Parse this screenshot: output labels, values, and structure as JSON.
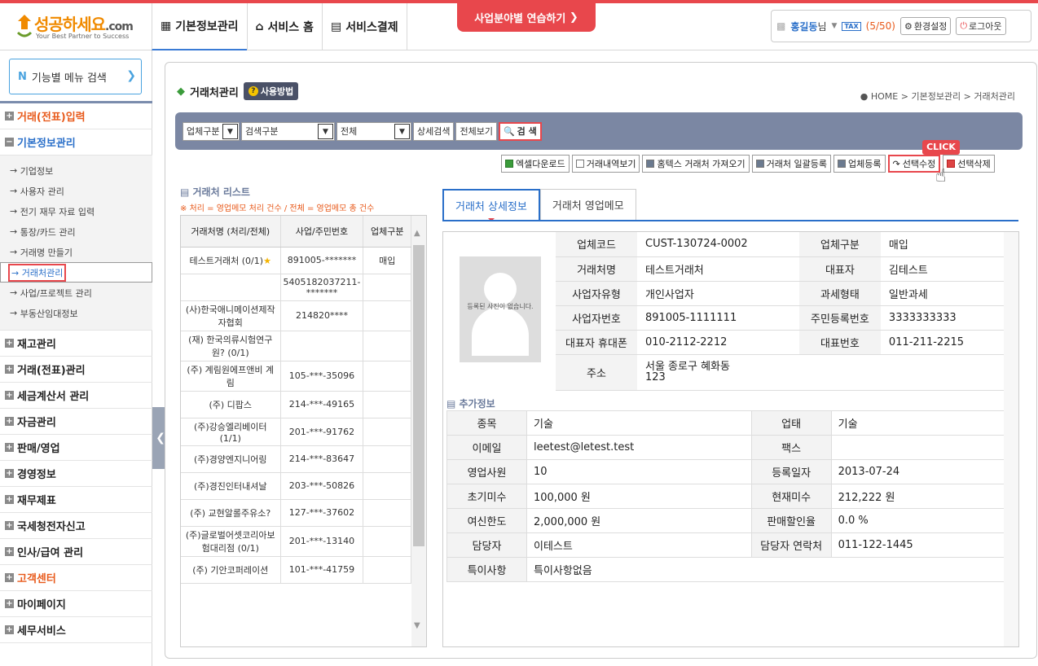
{
  "header": {
    "logo_main": "성공하세요",
    "logo_com": ".com",
    "logo_sub": "Your Best Partner to Success",
    "nav": [
      "기본정보관리",
      "서비스 홈",
      "서비스결제"
    ],
    "practice_btn": "사업분야별 연습하기",
    "user_name": "홍길동",
    "user_suffix": "님",
    "tax_label": "TAX",
    "tax_count": "(5/50)",
    "settings": "환경설정",
    "logout": "로그아웃"
  },
  "sidebar": {
    "func_search": "기능별 메뉴 검색",
    "menu": [
      {
        "label": "거래(전표)입력",
        "style": "orange"
      },
      {
        "label": "기본정보관리",
        "style": "blue"
      }
    ],
    "submenu": [
      "기업정보",
      "사용자 관리",
      "전기 재무 자료 입력",
      "통장/카드 관리",
      "거래명 만들기",
      "거래처관리",
      "사업/프로젝트 관리",
      "부동산임대정보"
    ],
    "menu2": [
      {
        "label": "재고관리",
        "style": ""
      },
      {
        "label": "거래(전표)관리",
        "style": ""
      },
      {
        "label": "세금계산서 관리",
        "style": ""
      },
      {
        "label": "자금관리",
        "style": ""
      },
      {
        "label": "판매/영업",
        "style": ""
      },
      {
        "label": "경영정보",
        "style": ""
      },
      {
        "label": "재무제표",
        "style": ""
      },
      {
        "label": "국세청전자신고",
        "style": ""
      },
      {
        "label": "인사/급여 관리",
        "style": ""
      },
      {
        "label": "고객센터",
        "style": "orange"
      },
      {
        "label": "마이페이지",
        "style": ""
      },
      {
        "label": "세무서비스",
        "style": ""
      }
    ]
  },
  "page": {
    "title": "거래처관리",
    "help_btn": "사용방법",
    "breadcrumb": "HOME > 기본정보관리 > 거래처관리"
  },
  "search": {
    "sel1": "업체구분",
    "sel2": "검색구분",
    "sel3": "전체",
    "detail_btn": "상세검색",
    "all_btn": "전체보기",
    "search_btn": "검 색"
  },
  "actions": [
    "엑셀다운로드",
    "거래내역보기",
    "홈텍스 거래처 가져오기",
    "거래처 일괄등록",
    "업체등록",
    "선택수정",
    "선택삭제"
  ],
  "click_tag": "CLICK",
  "list": {
    "title": "거래처 리스트",
    "note": "※ 처리 = 영업메모 처리 건수 / 전체 = 영업메모 총 건수",
    "headers": [
      "거래처명 (처리/전체)",
      "사업/주민번호",
      "업체구분"
    ],
    "rows": [
      [
        "테스트거래처 (0/1)",
        "891005-*******",
        "매입"
      ],
      [
        "",
        "5405182037211-*******",
        ""
      ],
      [
        "(사)한국애니메이션제작자협회",
        "214820****",
        ""
      ],
      [
        "(재) 한국의류시험연구원? (0/1)",
        "",
        ""
      ],
      [
        "(주) 계림원에프앤비 계림",
        "105-***-35096",
        ""
      ],
      [
        "(주) 디팝스",
        "214-***-49165",
        ""
      ],
      [
        "(주)강승엘리베이터 (1/1)",
        "201-***-91762",
        ""
      ],
      [
        "(주)경양엔지니어링",
        "214-***-83647",
        ""
      ],
      [
        "(주)경진인터내셔날",
        "203-***-50826",
        ""
      ],
      [
        "(주) 교현알롤주유소?",
        "127-***-37602",
        ""
      ],
      [
        "(주)글로벌어셋코리아보험대리점 (0/1)",
        "201-***-13140",
        ""
      ],
      [
        "(주) 기안코퍼레이션",
        "101-***-41759",
        ""
      ]
    ]
  },
  "tabs": [
    "거래처 상세정보",
    "거래처 영업메모"
  ],
  "detail": {
    "photo_text": "등록된 사진이 없습니다.",
    "rows": [
      [
        "업체코드",
        "CUST-130724-0002",
        "업체구분",
        "매입"
      ],
      [
        "거래처명",
        "테스트거래처",
        "대표자",
        "김테스트"
      ],
      [
        "사업자유형",
        "개인사업자",
        "과세형태",
        "일반과세"
      ],
      [
        "사업자번호",
        "891005-1111111",
        "주민등록번호",
        "3333333333"
      ],
      [
        "대표자 휴대폰",
        "010-2112-2212",
        "대표번호",
        "011-211-2215"
      ]
    ],
    "address_label": "주소",
    "address_line1": "서울 종로구 혜화동",
    "address_line2": "123"
  },
  "extra": {
    "title": "추가정보",
    "rows": [
      [
        "종목",
        "기술",
        "업태",
        "기술"
      ],
      [
        "이메일",
        "leetest@letest.test",
        "팩스",
        ""
      ],
      [
        "영업사원",
        "10",
        "등록일자",
        "2013-07-24"
      ],
      [
        "초기미수",
        "100,000 원",
        "현재미수",
        "212,222 원"
      ],
      [
        "여신한도",
        "2,000,000 원",
        "판매할인율",
        "0.0 %"
      ],
      [
        "담당자",
        "이테스트",
        "담당자 연락처",
        "011-122-1445"
      ]
    ],
    "memo_label": "특이사항",
    "memo_value": "특이사항없음"
  }
}
